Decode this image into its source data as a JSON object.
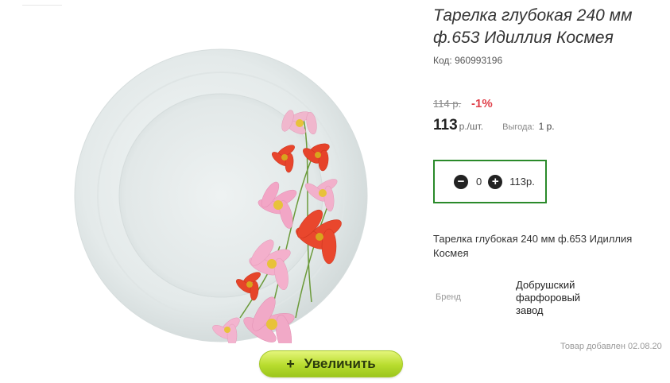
{
  "product": {
    "title": "Тарелка глубокая 240 мм ф.653 Идиллия Космея",
    "code_label": "Код:",
    "code_value": "960993196",
    "old_price": "114 р.",
    "discount": "-1%",
    "price_value": "113",
    "price_unit": "р./шт.",
    "benefit_label": "Выгода:",
    "benefit_value": "1 р.",
    "description": "Тарелка глубокая 240 мм ф.653 Идиллия Космея",
    "brand_label": "Бренд",
    "brand_value": "Добрушский фарфоровый завод",
    "added_text": "Товар добавлен 02.08.20"
  },
  "quantity": {
    "minus_icon": "minus-circle-icon",
    "plus_icon": "plus-circle-icon",
    "value": "0",
    "sum": "113р."
  },
  "image": {
    "zoom_plus": "+",
    "zoom_label": "Увеличить"
  },
  "colors": {
    "discount": "#e0404a",
    "qty_border": "#2a8a2a",
    "zoom_button": "#b8dc2e"
  }
}
